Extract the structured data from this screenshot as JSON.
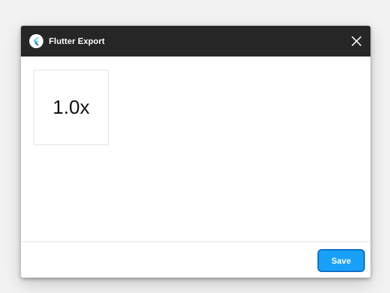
{
  "window": {
    "title": "Flutter Export",
    "logo_icon": "flutter-logo-icon",
    "close_icon": "close-icon"
  },
  "content": {
    "scale_options": [
      "1.0x"
    ]
  },
  "footer": {
    "save_label": "Save"
  },
  "colors": {
    "titlebar": "#262626",
    "accent": "#18a0fb",
    "accent_border": "#0c6fc4",
    "background": "#f2f2f2"
  }
}
